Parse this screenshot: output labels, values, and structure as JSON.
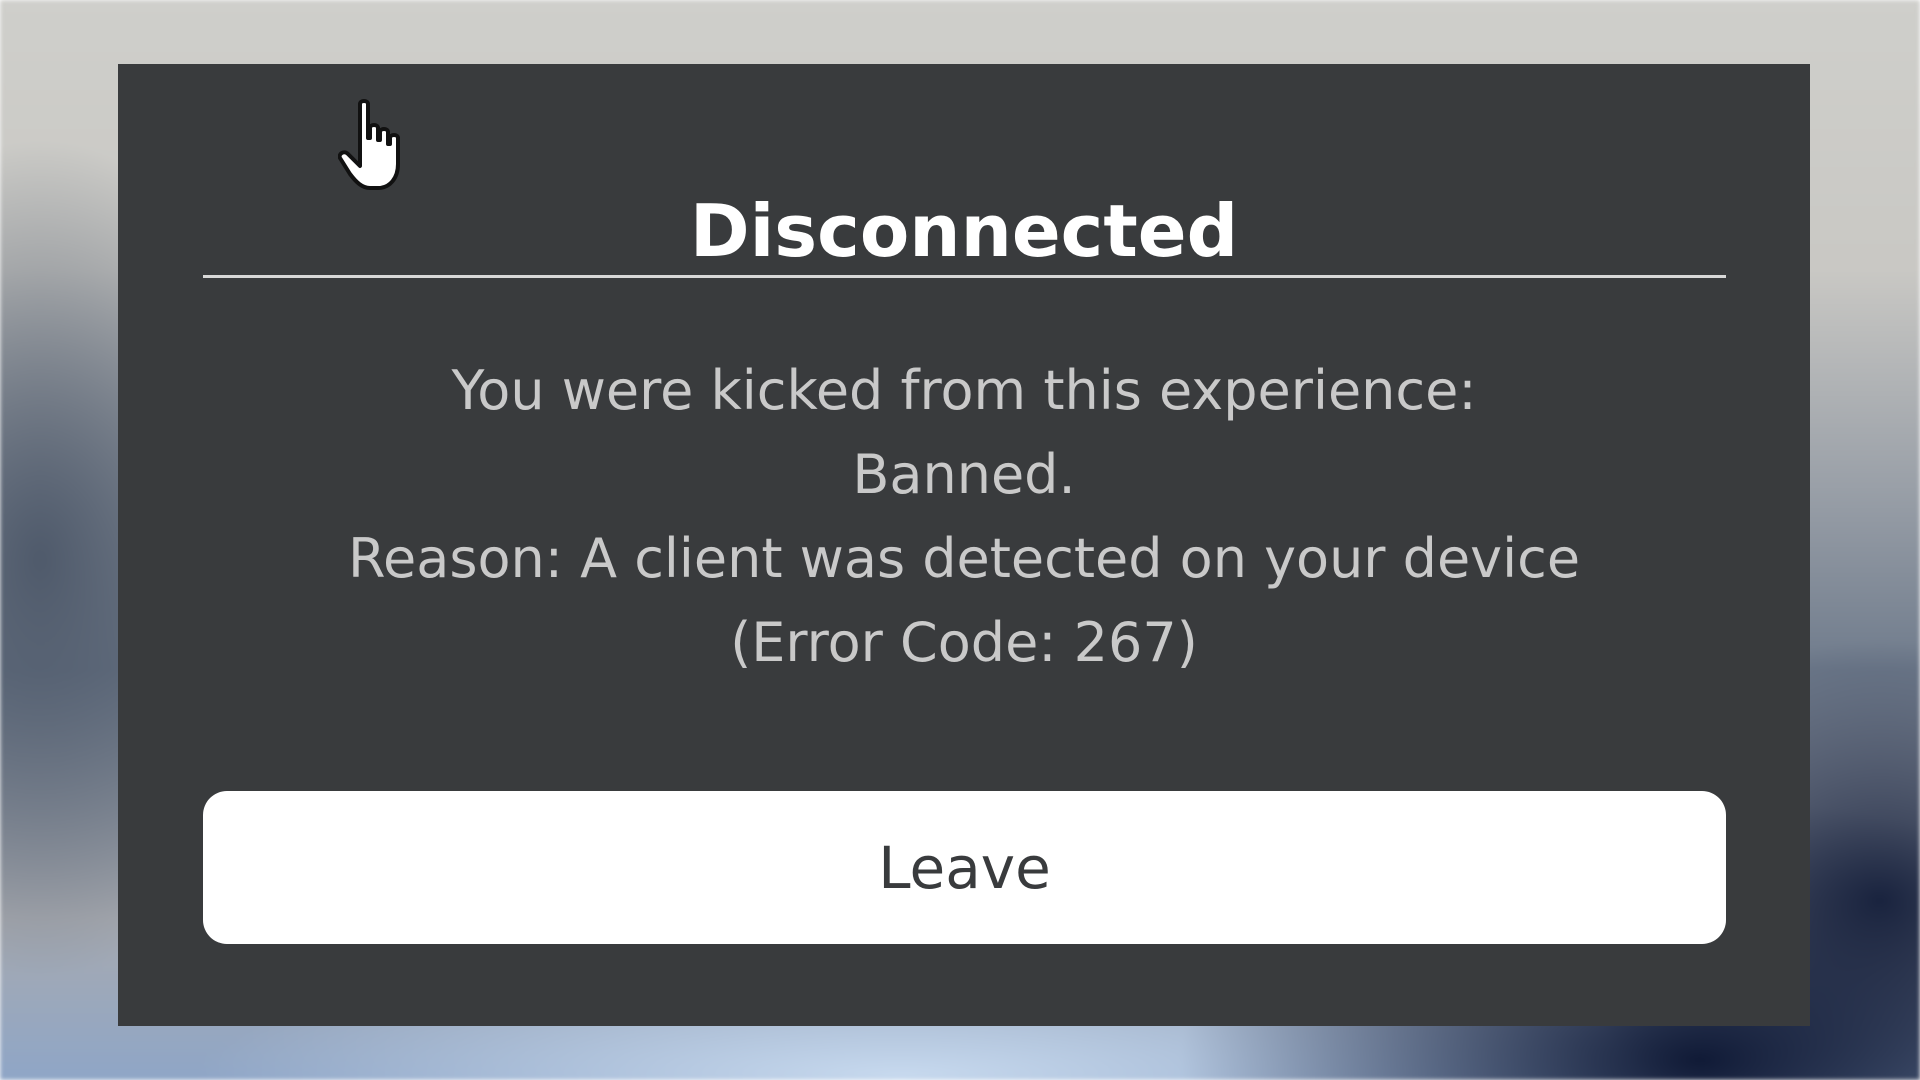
{
  "dialog": {
    "title": "Disconnected",
    "message_lines": [
      "You were kicked from this experience:",
      "Banned.",
      "Reason: A client was detected on your device",
      "(Error Code: 267)"
    ],
    "leave_label": "Leave"
  },
  "cursor": {
    "icon": "hand-pointer-icon"
  },
  "colors": {
    "dialog_bg": "#393b3d",
    "title_text": "#ffffff",
    "message_text": "#c9c9c9",
    "button_bg": "#ffffff",
    "button_text": "#393b3d"
  }
}
